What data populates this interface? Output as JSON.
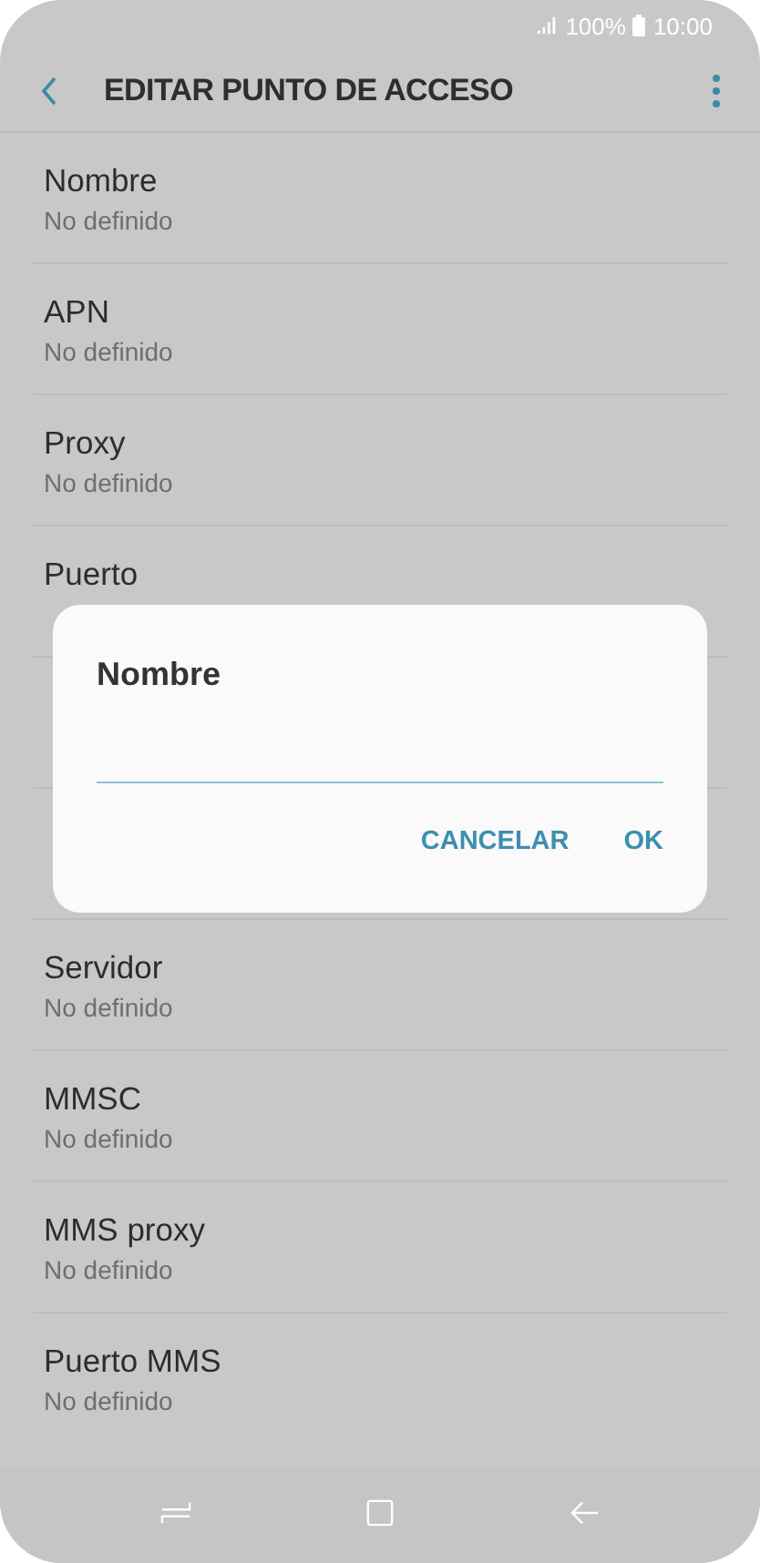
{
  "status_bar": {
    "battery": "100%",
    "time": "10:00"
  },
  "header": {
    "title": "EDITAR PUNTO DE ACCESO"
  },
  "rows": [
    {
      "kind": "setting",
      "title": "Nombre",
      "subtitle": "No definido"
    },
    {
      "kind": "setting",
      "title": "APN",
      "subtitle": "No definido"
    },
    {
      "kind": "setting",
      "title": "Proxy",
      "subtitle": "No definido"
    },
    {
      "kind": "title_only",
      "title": "Puerto"
    },
    {
      "kind": "covered"
    },
    {
      "kind": "covered"
    },
    {
      "kind": "setting",
      "title": "Servidor",
      "subtitle": "No definido"
    },
    {
      "kind": "setting",
      "title": "MMSC",
      "subtitle": "No definido"
    },
    {
      "kind": "setting",
      "title": "MMS proxy",
      "subtitle": "No definido"
    },
    {
      "kind": "setting",
      "title": "Puerto MMS",
      "subtitle": "No definido"
    }
  ],
  "dialog": {
    "title": "Nombre",
    "buttons": [
      "CANCELAR",
      "OK"
    ]
  }
}
